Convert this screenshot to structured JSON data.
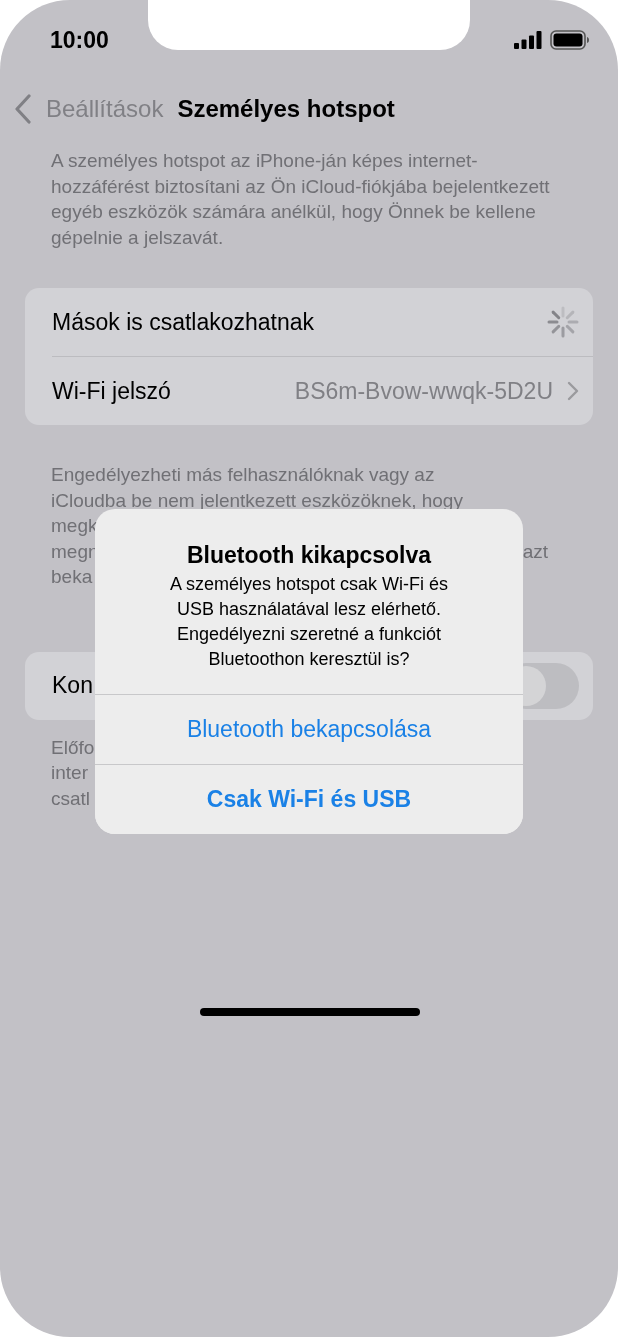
{
  "status_bar": {
    "time": "10:00"
  },
  "nav": {
    "back": "Beállítások",
    "title": "Személyes hotspot"
  },
  "intro": "A személyes hotspot az iPhone-ján képes internet-hozzáférést biztosítani az Ön iCloud-fiókjába bejelentkezett egyéb eszközök számára anélkül, hogy Önnek be kellene gépelnie a jelszavát.",
  "settings": [
    {
      "kind": "loading",
      "label": "Mások is csatlakozhatnak"
    },
    {
      "kind": "link",
      "label": "Wi-Fi jelszó",
      "value": "BS6m-Bvow-wwqk-5D2U"
    }
  ],
  "note_lines": [
    {
      "left": "Engedélyezheti más felhasználóknak vagy az"
    },
    {
      "left": "iCloudba be nem jelentkezett eszközöknek, hogy"
    },
    {
      "left": "megk"
    },
    {
      "left": "megn",
      "right": "azt"
    },
    {
      "left": "beka"
    }
  ],
  "compat": {
    "label": "Kon",
    "on": false
  },
  "compat_note_lines": [
    "Előfo",
    "inter",
    "csatl"
  ],
  "alert": {
    "title": "Bluetooth kikapcsolva",
    "message": "A személyes hotspot csak Wi-Fi és\nUSB használatával lesz elérhető.\nEngedélyezni szeretné a funkciót\nBluetoothon keresztül is?",
    "actions": [
      {
        "label": "Bluetooth bekapcsolása",
        "preferred": false
      },
      {
        "label": "Csak Wi-Fi és USB",
        "preferred": true
      }
    ]
  }
}
